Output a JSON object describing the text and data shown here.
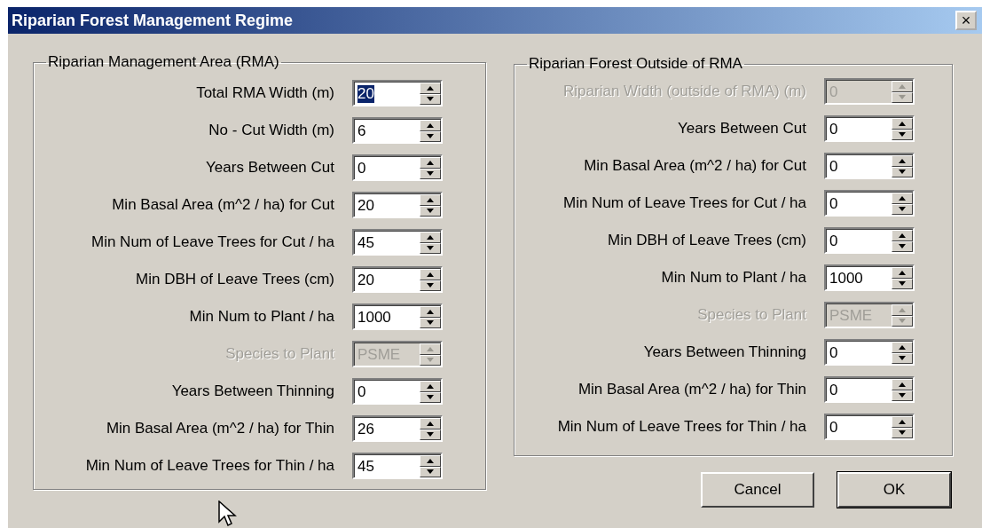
{
  "window": {
    "title": "Riparian Forest Management Regime",
    "close": "×"
  },
  "groups": [
    {
      "title": "Riparian Management Area (RMA)",
      "rows": [
        {
          "label": "Total RMA Width (m)",
          "value": "20",
          "disabled": false,
          "selected": true
        },
        {
          "label": "No - Cut Width (m)",
          "value": "6",
          "disabled": false,
          "selected": false
        },
        {
          "label": "Years Between Cut",
          "value": "0",
          "disabled": false,
          "selected": false
        },
        {
          "label": "Min Basal Area (m^2 / ha)  for Cut",
          "value": "20",
          "disabled": false,
          "selected": false
        },
        {
          "label": "Min  Num of Leave Trees  for Cut / ha",
          "value": "45",
          "disabled": false,
          "selected": false
        },
        {
          "label": "Min  DBH of Leave Trees (cm)",
          "value": "20",
          "disabled": false,
          "selected": false
        },
        {
          "label": "Min Num to Plant / ha",
          "value": "1000",
          "disabled": false,
          "selected": false
        },
        {
          "label": "Species to Plant",
          "value": "PSME",
          "disabled": true,
          "selected": false
        },
        {
          "label": "Years Between Thinning",
          "value": "0",
          "disabled": false,
          "selected": false
        },
        {
          "label": "Min Basal Area (m^2 / ha) for Thin",
          "value": "26",
          "disabled": false,
          "selected": false
        },
        {
          "label": "Min Num of Leave Trees for Thin / ha",
          "value": "45",
          "disabled": false,
          "selected": false
        }
      ]
    },
    {
      "title": "Riparian Forest Outside of RMA",
      "rows": [
        {
          "label": "Riparian Width (outside of RMA) (m)",
          "value": "0",
          "disabled": true,
          "selected": false
        },
        {
          "label": "Years Between Cut",
          "value": "0",
          "disabled": false,
          "selected": false
        },
        {
          "label": "Min Basal Area (m^2 / ha)  for Cut",
          "value": "0",
          "disabled": false,
          "selected": false
        },
        {
          "label": "Min Num of  Leave Trees  for Cut / ha",
          "value": "0",
          "disabled": false,
          "selected": false
        },
        {
          "label": "Min DBH of Leave Trees (cm)",
          "value": "0",
          "disabled": false,
          "selected": false
        },
        {
          "label": "Min Num to Plant / ha",
          "value": "1000",
          "disabled": false,
          "selected": false
        },
        {
          "label": "Species to Plant",
          "value": "PSME",
          "disabled": true,
          "selected": false
        },
        {
          "label": "Years Between Thinning",
          "value": "0",
          "disabled": false,
          "selected": false
        },
        {
          "label": "Min Basal Area (m^2 / ha) for Thin",
          "value": "0",
          "disabled": false,
          "selected": false
        },
        {
          "label": "Min Num of  Leave Trees  for Thin / ha",
          "value": "0",
          "disabled": false,
          "selected": false
        }
      ]
    }
  ],
  "buttons": [
    {
      "label": "Cancel",
      "default": false
    },
    {
      "label": "OK",
      "default": true
    }
  ]
}
